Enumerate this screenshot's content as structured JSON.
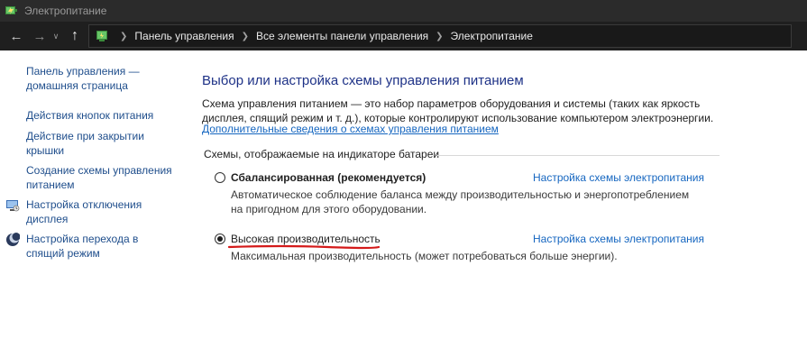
{
  "window": {
    "title": "Электропитание"
  },
  "nav": {
    "breadcrumbs": [
      "Панель управления",
      "Все элементы панели управления",
      "Электропитание"
    ]
  },
  "sidebar": {
    "items": [
      {
        "label": "Панель управления — домашняя страница",
        "icon": null
      },
      {
        "label": "Действия кнопок питания",
        "icon": null
      },
      {
        "label": "Действие при закрытии крышки",
        "icon": null
      },
      {
        "label": "Создание схемы управления питанием",
        "icon": null
      },
      {
        "label": "Настройка отключения дисплея",
        "icon": "display-off-icon"
      },
      {
        "label": "Настройка перехода в спящий режим",
        "icon": "sleep-moon-icon"
      }
    ]
  },
  "main": {
    "heading": "Выбор или настройка схемы управления питанием",
    "description": "Схема управления питанием — это набор параметров оборудования и системы (таких как яркость дисплея, спящий режим и т. д.), которые контролируют использование компьютером электроэнергии.",
    "more_link": "Дополнительные сведения о схемах управления питанием",
    "section_label": "Схемы, отображаемые на индикаторе батареи",
    "plans": [
      {
        "name": "Сбалансированная (рекомендуется)",
        "description": "Автоматическое соблюдение баланса между производительностью и энергопотреблением на пригодном для этого оборудовании.",
        "settings_link": "Настройка схемы электропитания",
        "selected": false
      },
      {
        "name": "Высокая производительность",
        "description": "Максимальная производительность (может потребоваться больше энергии).",
        "settings_link": "Настройка схемы электропитания",
        "selected": true
      }
    ]
  },
  "colors": {
    "titlebar_bg": "#2b2b2b",
    "navbar_bg": "#1f1f1f",
    "link": "#1566c0",
    "heading": "#1e3287",
    "annotation": "#d41a1a"
  }
}
